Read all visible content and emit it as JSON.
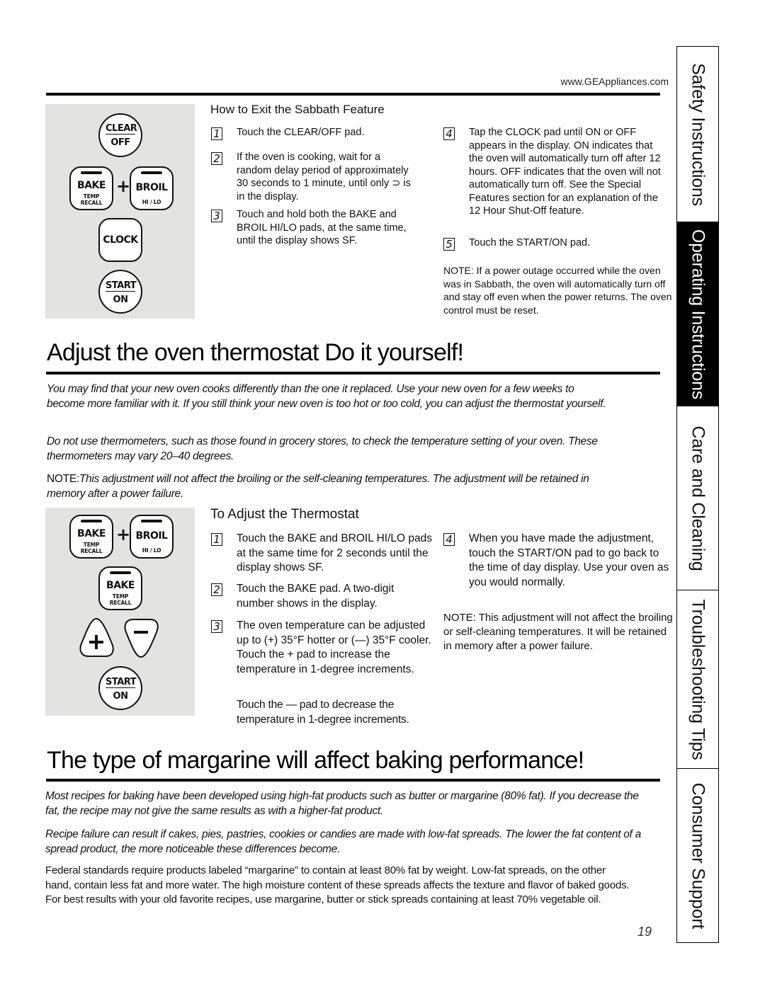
{
  "header": {
    "site_url": "www.GEAppliances.com"
  },
  "side_tabs": [
    {
      "label": "Safety Instructions",
      "active": false
    },
    {
      "label": "Operating Instructions",
      "active": true
    },
    {
      "label": "Care and Cleaning",
      "active": false
    },
    {
      "label": "Troubleshooting Tips",
      "active": false
    },
    {
      "label": "Consumer Support",
      "active": false
    }
  ],
  "sabbath_exit": {
    "title": "How to Exit the Sabbath Feature",
    "keypad": {
      "clear_top": "CLEAR",
      "clear_bot": "OFF",
      "bake": "BAKE",
      "bake_sub1": "TEMP",
      "bake_sub2": "RECALL",
      "plus": "+",
      "broil": "BROIL",
      "broil_sub": "HI / LO",
      "clock": "CLOCK",
      "start_top": "START",
      "start_bot": "ON"
    },
    "steps": [
      {
        "num": "1",
        "text": "Touch the CLEAR/OFF pad."
      },
      {
        "num": "2",
        "text": "If the oven is cooking, wait for a random delay period of approximately 30 seconds to 1 minute, until only ⊃ is in the display."
      },
      {
        "num": "3",
        "text": "Touch and hold both the BAKE and BROIL HI/LO pads, at the same time, until the display shows SF."
      },
      {
        "num": "4",
        "text": "Tap the CLOCK pad until ON or OFF appears in the display. ON indicates that the oven will automatically turn off after 12 hours. OFF indicates that the oven will not automatically turn off. See the Special Features section for an explanation of the 12 Hour Shut-Off feature."
      },
      {
        "num": "5",
        "text": "Touch the START/ON pad."
      }
    ],
    "note": "NOTE: If a power outage occurred while the oven was in Sabbath, the oven will automatically turn off and stay off even when the power returns. The oven control must be reset."
  },
  "thermostat": {
    "heading": "Adjust the oven thermostat Do it yourself!",
    "intro_1": "You may find that your new oven cooks differently than the one it replaced. Use your new oven for a few weeks to become more familiar with it. If you still think your new oven is too hot or too cold, you can adjust the thermostat yourself.",
    "intro_2": "Do not use thermometers, such as those found in grocery stores, to check the temperature setting of your oven. These thermometers may vary 20–40 degrees.",
    "intro_note_label": "NOTE:",
    "intro_note": "This adjustment will not affect the broiling or the self-cleaning temperatures. The adjustment will be retained in memory after a power failure.",
    "subheading": "To Adjust the Thermostat",
    "keypad": {
      "bake": "BAKE",
      "bake_sub1": "TEMP",
      "bake_sub2": "RECALL",
      "plus": "+",
      "broil": "BROIL",
      "broil_sub": "HI / LO",
      "plus_key": "+",
      "minus_key": "−",
      "start_top": "START",
      "start_bot": "ON"
    },
    "steps": [
      {
        "num": "1",
        "text": "Touch the BAKE and BROIL HI/LO pads at the same time for 2 seconds until the display shows SF."
      },
      {
        "num": "2",
        "text": "Touch the BAKE pad. A two-digit number shows in the display."
      },
      {
        "num": "3",
        "text": "The oven temperature can be adjusted up to (+) 35°F hotter or (—) 35°F cooler. Touch the + pad to increase the temperature in 1-degree increments."
      },
      {
        "num": "4",
        "text": "When you have made the adjustment, touch the START/ON pad to go back to the time of day display. Use your oven as you would normally."
      }
    ],
    "step3_extra": "Touch the — pad to decrease the temperature in 1-degree increments.",
    "note": "NOTE: This adjustment will not affect the broiling or self-cleaning temperatures. It will be retained in memory after a power failure."
  },
  "margarine": {
    "heading": "The type of margarine will affect baking performance!",
    "para_1": "Most recipes for baking have been developed using high-fat products such as butter or margarine (80% fat). If you decrease the fat, the recipe may not give the same results as with a higher-fat product.",
    "para_2": "Recipe failure can result if cakes, pies, pastries, cookies or candies are made with low-fat spreads. The lower the fat content of a spread product, the more noticeable these differences become.",
    "para_3": "Federal standards require products labeled “margarine” to contain at least 80% fat by weight. Low-fat spreads, on the other hand, contain less fat and more water. The high moisture content of these spreads affects the texture and flavor of baked goods. For best results with your old favorite recipes, use margarine, butter or stick spreads containing at least 70% vegetable oil."
  },
  "footer": {
    "page_number": "19"
  }
}
